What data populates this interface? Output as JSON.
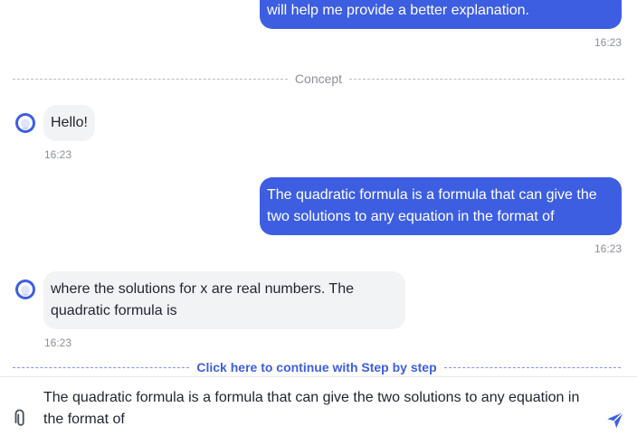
{
  "messages": [
    {
      "role": "user",
      "text": "will help me provide a better explanation.",
      "time": "16:23"
    },
    {
      "role": "assistant",
      "text": "Hello!",
      "time": "16:23"
    },
    {
      "role": "user",
      "text": "The quadratic formula is a formula that can give the two solutions to any equation in the format of",
      "time": "16:23"
    },
    {
      "role": "assistant",
      "text": "where the solutions for x are real numbers. The quadratic formula is",
      "time": "16:23"
    }
  ],
  "divider": {
    "label": "Concept"
  },
  "continue_link": {
    "label": "Click here to continue with Step by step"
  },
  "composer": {
    "value": "The quadratic formula is a formula that can give the two solutions to any equation in the format of",
    "attach_icon": "paperclip-icon",
    "send_icon": "send-icon"
  },
  "colors": {
    "accent": "#3d5ee1",
    "bot_bubble": "#f2f3f5",
    "timestamp": "#8b8f98"
  }
}
